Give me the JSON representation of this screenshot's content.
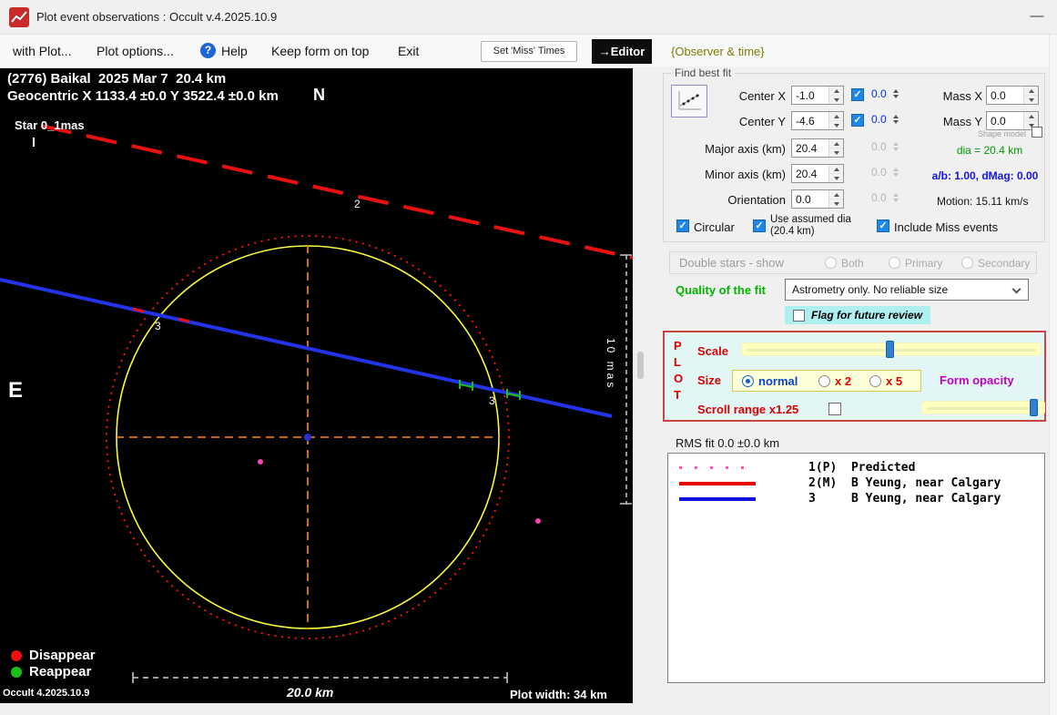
{
  "window": {
    "title": "Plot event observations : Occult v.4.2025.10.9",
    "minimize_glyph": "—"
  },
  "menubar": {
    "with_plot": "with Plot...",
    "plot_options": "Plot options...",
    "help": "Help",
    "keep_on_top": "Keep form on top",
    "exit": "Exit",
    "set_miss_times": "Set 'Miss' Times",
    "editor": "→Editor",
    "observer_time": "{Observer & time}"
  },
  "plot": {
    "header_line1": "(2776) Baikal  2025 Mar 7  20.4 km",
    "header_line2": "Geocentric X 1133.4 ±0.0 Y 3522.4 ±0.0 km",
    "north": "N",
    "east": "E",
    "star_scale": "Star 0_1mas",
    "chord2": "2",
    "chord3_left": "3",
    "chord3_right": "3",
    "legend_disappear": "Disappear",
    "legend_reappear": "Reappear",
    "version": "Occult 4.2025.10.9",
    "scale_bar": "20.0 km",
    "plot_width": "Plot width: 34 km",
    "mas_scale": "10 mas"
  },
  "find_best_fit": {
    "legend": "Find best fit",
    "center_x_label": "Center X",
    "center_x": "-1.0",
    "center_x_err": "0.0",
    "mass_x_label": "Mass X",
    "mass_x": "0.0",
    "center_y_label": "Center Y",
    "center_y": "-4.6",
    "center_y_err": "0.0",
    "mass_y_label": "Mass Y",
    "mass_y": "0.0",
    "shape_model_label": "Shape model",
    "major_axis_label": "Major axis (km)",
    "major_axis": "20.4",
    "major_axis_err": "0.0",
    "dia_text": "dia = 20.4 km",
    "minor_axis_label": "Minor axis (km)",
    "minor_axis": "20.4",
    "minor_axis_err": "0.0",
    "ab_text": "a/b: 1.00, dMag: 0.00",
    "orientation_label": "Orientation",
    "orientation": "0.0",
    "orientation_err": "0.0",
    "motion_text": "Motion: 15.11 km/s",
    "circular_label": "Circular",
    "use_assumed_label": "Use assumed dia (20.4 km)",
    "include_miss_label": "Include Miss events"
  },
  "double_stars": {
    "label": "Double stars - show",
    "both": "Both",
    "primary": "Primary",
    "secondary": "Secondary"
  },
  "quality": {
    "label": "Quality of the fit",
    "value": "Astrometry only. No reliable size",
    "flag_label": "Flag for future review"
  },
  "plot_panel": {
    "letters": [
      "P",
      "L",
      "O",
      "T"
    ],
    "scale_label": "Scale",
    "size_label": "Size",
    "size_options": [
      "normal",
      "x 2",
      "x 5"
    ],
    "form_opacity": "Form opacity",
    "scroll_range": "Scroll range x1.25"
  },
  "rms": {
    "label": "RMS fit 0.0 ±0.0 km"
  },
  "observations": {
    "rows": [
      {
        "text": "1(P)  Predicted"
      },
      {
        "text": "2(M)  B Yeung, near Calgary"
      },
      {
        "text": "3     B Yeung, near Calgary"
      }
    ]
  },
  "colors": {
    "checkbox_blue": "#1f87e8",
    "panel_border_red": "#cb4444",
    "fit_green": "#00b400",
    "value_blue": "#1414e8",
    "label_red": "#dd0000",
    "form_opacity_magenta": "#c400c4",
    "observer_olive": "#7c7c00",
    "chord_red": "#e81111",
    "chord_blue": "#2233e8",
    "asteroid_yellow": "#fafa3c",
    "crosshair_orange": "#ff8c00"
  }
}
